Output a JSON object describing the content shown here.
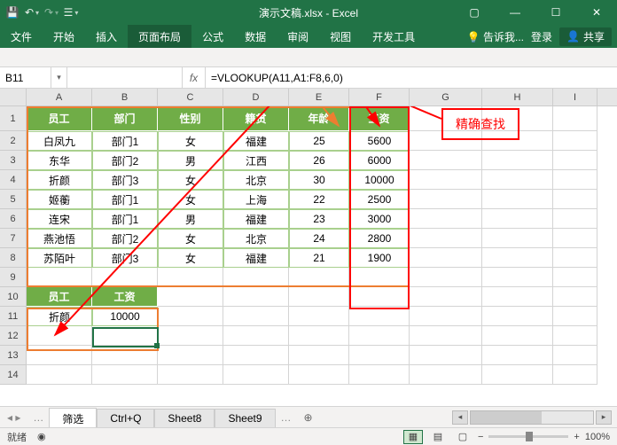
{
  "title": "演示文稿.xlsx - Excel",
  "ribbon": {
    "tabs": [
      "文件",
      "开始",
      "插入",
      "页面布局",
      "公式",
      "数据",
      "审阅",
      "视图",
      "开发工具"
    ],
    "active_index": 3,
    "tell_me": "告诉我...",
    "sign_in": "登录",
    "share": "共享"
  },
  "name_box": "B11",
  "fx": "fx",
  "formula": "=VLOOKUP(A11,A1:F8,6,0)",
  "col_headers": [
    "A",
    "B",
    "C",
    "D",
    "E",
    "F",
    "G",
    "H",
    "I"
  ],
  "row_headers": [
    "1",
    "2",
    "3",
    "4",
    "5",
    "6",
    "7",
    "8",
    "9",
    "10",
    "11",
    "12",
    "13",
    "14"
  ],
  "table1": {
    "headers": [
      "员工",
      "部门",
      "性别",
      "籍贯",
      "年龄",
      "工资"
    ],
    "rows": [
      [
        "白凤九",
        "部门1",
        "女",
        "福建",
        "25",
        "5600"
      ],
      [
        "东华",
        "部门2",
        "男",
        "江西",
        "26",
        "6000"
      ],
      [
        "折颜",
        "部门3",
        "女",
        "北京",
        "30",
        "10000"
      ],
      [
        "姬蘅",
        "部门1",
        "女",
        "上海",
        "22",
        "2500"
      ],
      [
        "连宋",
        "部门1",
        "男",
        "福建",
        "23",
        "3000"
      ],
      [
        "燕池悟",
        "部门2",
        "女",
        "北京",
        "24",
        "2800"
      ],
      [
        "苏陌叶",
        "部门3",
        "女",
        "福建",
        "21",
        "1900"
      ]
    ]
  },
  "table2": {
    "headers": [
      "员工",
      "工资"
    ],
    "rows": [
      [
        "折颜",
        "10000"
      ]
    ]
  },
  "annotation": {
    "exact_match": "精确查找"
  },
  "sheet_tabs": {
    "items": [
      "筛选",
      "Ctrl+Q",
      "Sheet8",
      "Sheet9"
    ],
    "active": "筛选"
  },
  "status": {
    "ready": "就绪",
    "accessibility_icon": "⬚",
    "zoom": "100%"
  }
}
